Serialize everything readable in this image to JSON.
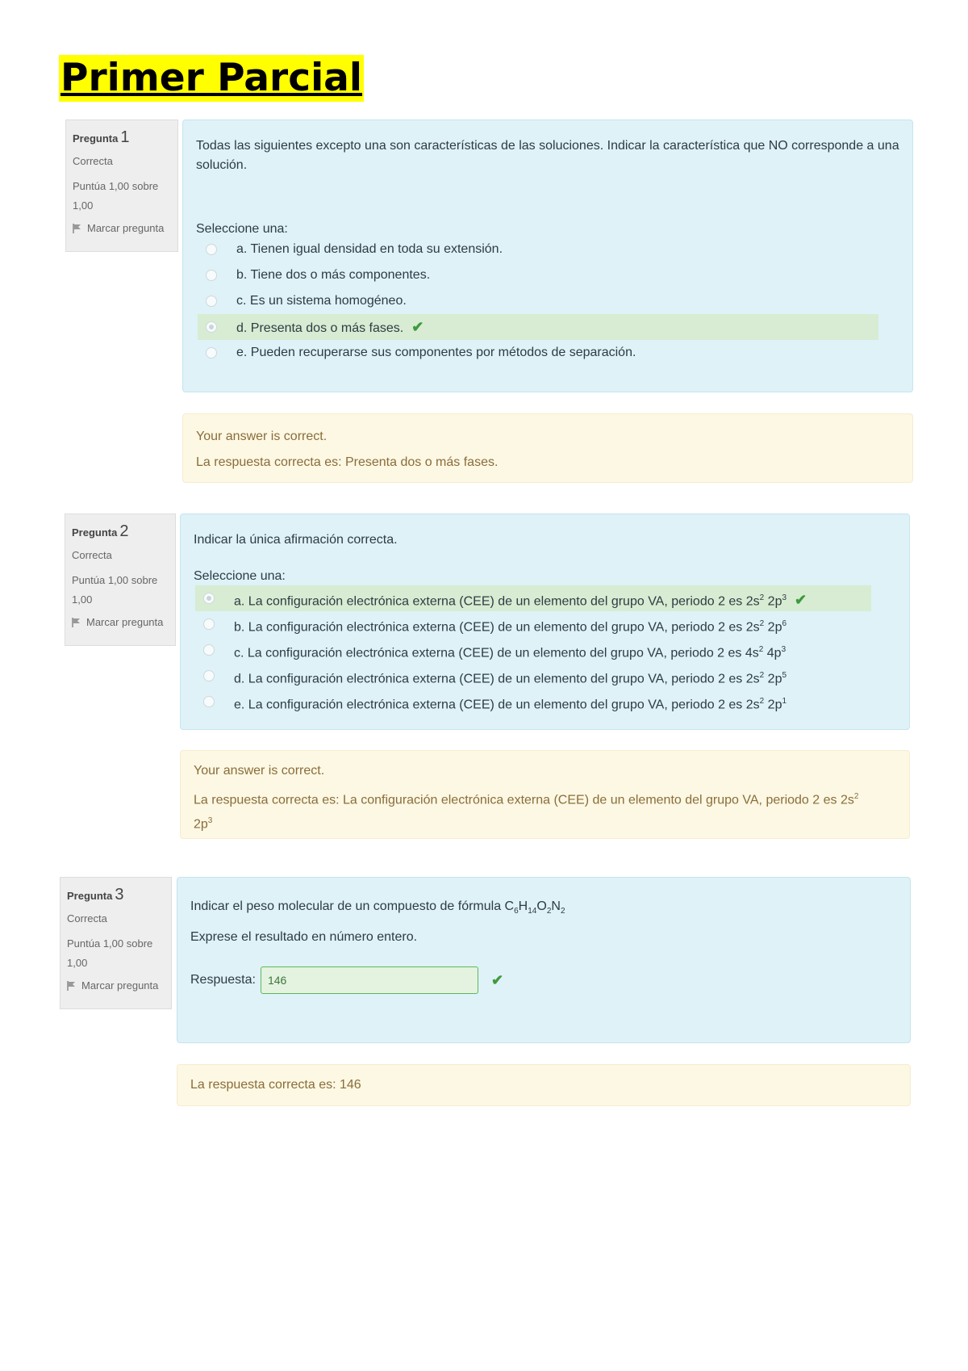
{
  "page_title": "Primer Parcial",
  "colors": {
    "title_highlight": "#ffff00",
    "question_bg": "#def2f8",
    "feedback_bg": "#fcf8e3",
    "correct_bg": "#d7ecd2",
    "check": "#3f9a3f"
  },
  "questions": [
    {
      "label": "Pregunta",
      "number": "1",
      "state": "Correcta",
      "grade": "Puntúa 1,00 sobre 1,00",
      "flag_label": "Marcar pregunta",
      "text": "Todas las siguientes excepto una son características de las soluciones. Indicar la característica que NO corresponde a una solución.",
      "prompt": "Seleccione una:",
      "options": [
        {
          "text": "a. Tienen igual densidad en toda su extensión.",
          "checked": false
        },
        {
          "text": "b. Tiene dos o más componentes.",
          "checked": false
        },
        {
          "text": "c. Es un sistema homogéneo.",
          "checked": false
        },
        {
          "text": "d. Presenta dos o más fases.",
          "checked": true
        },
        {
          "text": "e. Pueden recuperarse sus componentes por métodos de separación.",
          "checked": false
        }
      ],
      "feedback_general": "Your answer is correct.",
      "feedback_right": "La respuesta correcta es: Presenta dos o más fases."
    },
    {
      "label": "Pregunta",
      "number": "2",
      "state": "Correcta",
      "grade": "Puntúa 1,00 sobre 1,00",
      "flag_label": "Marcar pregunta",
      "text": "Indicar la única afirmación correcta.",
      "prompt": "Seleccione una:",
      "options": [
        {
          "text": "a. La configuración electrónica externa (CEE) de un elemento del grupo VA, periodo 2 es 2s",
          "s_exp": "2",
          "p": " 2p",
          "p_exp": "3",
          "checked": true
        },
        {
          "text": "b. La configuración electrónica externa (CEE) de un elemento del grupo VA, periodo 2 es 2s",
          "s_exp": "2",
          "p": " 2p",
          "p_exp": "6",
          "checked": false
        },
        {
          "text": "c. La configuración electrónica externa (CEE) de un elemento del grupo VA, periodo 2 es 4s",
          "s_exp": "2",
          "p": " 4p",
          "p_exp": "3",
          "checked": false
        },
        {
          "text": "d. La configuración electrónica externa (CEE) de un elemento del grupo VA, periodo 2 es 2s",
          "s_exp": "2",
          "p": " 2p",
          "p_exp": "5",
          "checked": false
        },
        {
          "text": "e. La configuración electrónica externa (CEE) de un elemento del grupo VA, periodo 2 es 2s",
          "s_exp": "2",
          "p": " 2p",
          "p_exp": "1",
          "checked": false
        }
      ],
      "feedback_general": "Your answer is correct.",
      "feedback_right": "La respuesta correcta es: La configuración electrónica externa (CEE) de un elemento del grupo VA, periodo 2 es 2s",
      "feedback_s_exp": "2",
      "feedback_p": "2p",
      "feedback_p_exp": "3"
    },
    {
      "label": "Pregunta",
      "number": "3",
      "state": "Correcta",
      "grade": "Puntúa 1,00 sobre 1,00",
      "flag_label": "Marcar pregunta",
      "text_prefix": "Indicar el peso molecular de un compuesto de fórmula C",
      "formula_sub1": "6",
      "formula_h": "H",
      "formula_sub2": "14",
      "formula_o": "O",
      "formula_sub3": "2",
      "formula_n": "N",
      "formula_sub4": "2",
      "text2": "Exprese el resultado en número entero.",
      "answer_label": "Respuesta:",
      "answer_value": "146",
      "feedback_right": "La respuesta correcta es: 146"
    }
  ]
}
